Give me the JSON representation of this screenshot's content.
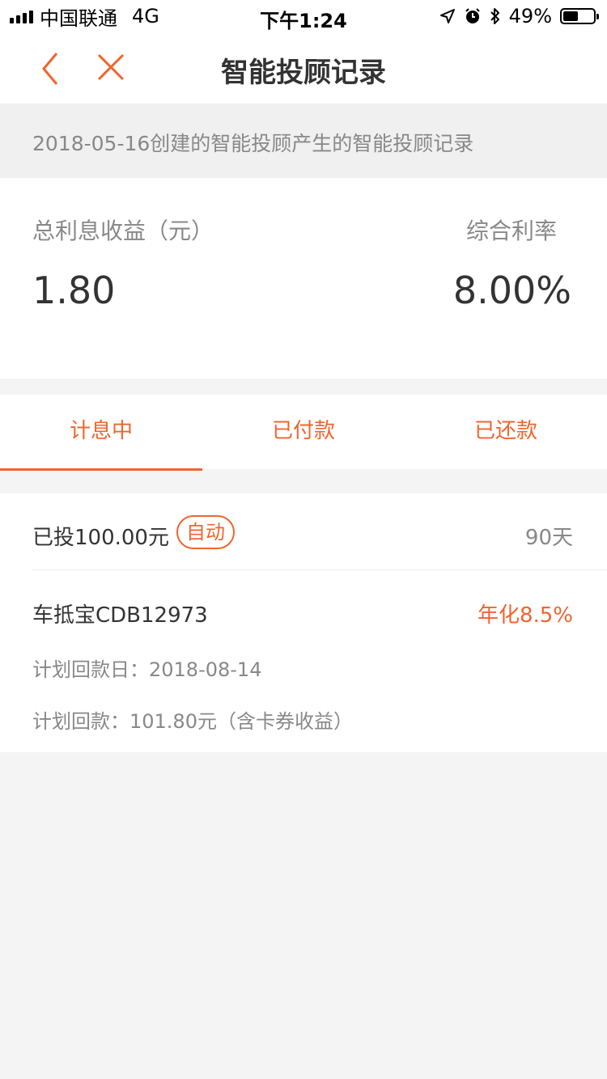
{
  "status_bar": {
    "carrier": "中国联通",
    "network": "4G",
    "time": "下午1:24",
    "battery_percent": "49%",
    "battery_level": 0.49
  },
  "nav": {
    "title": "智能投顾记录",
    "back_icon": "chevron-left-icon",
    "close_icon": "close-icon",
    "accent_color": "#f0652d"
  },
  "banner": {
    "text": "2018-05-16创建的智能投顾产生的智能投顾记录"
  },
  "summary": {
    "total_interest_label": "总利息收益（元）",
    "total_interest_value": "1.80",
    "rate_label": "综合利率",
    "rate_value": "8.00%"
  },
  "tabs": [
    {
      "label": "计息中",
      "active": true
    },
    {
      "label": "已付款",
      "active": false
    },
    {
      "label": "已还款",
      "active": false
    }
  ],
  "record": {
    "invested": "已投100.00元",
    "badge": "自动",
    "days": "90天",
    "product": "车抵宝CDB12973",
    "annual_rate": "年化8.5%",
    "planned_date": "计划回款日：2018-08-14",
    "planned_amount": "计划回款：101.80元（含卡券收益）"
  }
}
